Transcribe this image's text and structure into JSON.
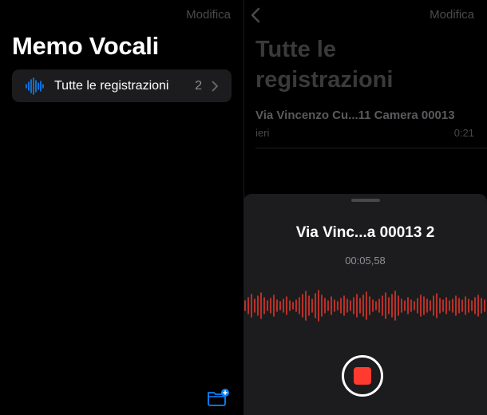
{
  "colors": {
    "accent": "#0a84ff",
    "record": "#ff3b30",
    "waveform": "#e0352b",
    "card": "#1c1c1e",
    "dim_text": "#4a4a4c"
  },
  "left_pane": {
    "edit_label": "Modifica",
    "title": "Memo Vocali",
    "all_recordings": {
      "icon": "waveform-icon",
      "label": "Tutte le registrazioni",
      "count": "2",
      "chevron": "chevron-right-icon"
    },
    "new_folder_icon": "folder-badge-plus-icon"
  },
  "right_pane": {
    "back_icon": "chevron-left-icon",
    "edit_label": "Modifica",
    "title": "Tutte le registrazioni",
    "recordings": [
      {
        "name": "Via Vincenzo Cu...11 Camera 00013",
        "date": "ieri",
        "duration": "0:21"
      }
    ]
  },
  "recording_sheet": {
    "title": "Via Vinc...a 00013 2",
    "elapsed": "00:05,58",
    "record_button_icon": "stop-icon"
  }
}
